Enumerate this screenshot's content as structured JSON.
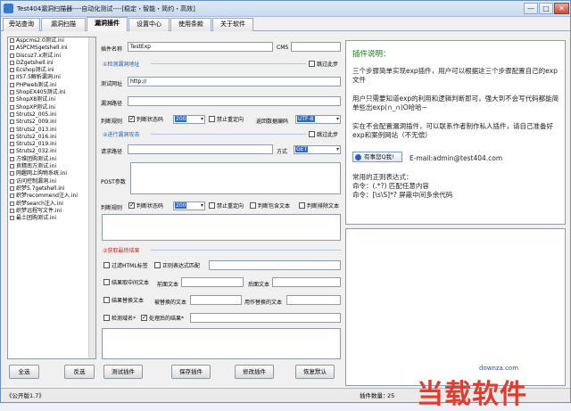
{
  "window": {
    "title": "Test404漏洞扫描器----自动化测试----[稳定・智能・简约・高效]",
    "controls": {
      "minimize": "—",
      "maximize": "□",
      "close": "✕"
    }
  },
  "tabs": [
    {
      "label": "旁站查询"
    },
    {
      "label": "漏洞扫描"
    },
    {
      "label": "漏洞插件",
      "active": true
    },
    {
      "label": "设置中心"
    },
    {
      "label": "使用条款"
    },
    {
      "label": "关于软件"
    }
  ],
  "plugin_list": [
    "Aspcms2.0测试.ini",
    "ASPCMSgetshell.ini",
    "Discuz7.x测试.ini",
    "DZgetshell.ini",
    "Ecshop测试.ini",
    "IIS7.5解析漏洞.ini",
    "PHPweb测试.ini",
    "ShopEX405测试.ini",
    "ShopX8测试.ini",
    "ShopXP测试.ini",
    "Struts2_005.ini",
    "Struts2_009.ini",
    "Struts2_013.ini",
    "Struts2_016.ini",
    "Struts2_019.ini",
    "Struts2_032.ini",
    "方维团购测试.ini",
    "良精南方测试.ini",
    "网趣网上购物系统.ini",
    "访问控制漏洞.ini",
    "织梦5.7getshell.ini",
    "织梦recommend注入.ini",
    "织梦search注入.ini",
    "织梦远程写文件.ini",
    "最土团购测试.ini"
  ],
  "form": {
    "plugin_name_label": "插件名称",
    "plugin_name_value": "TestExp",
    "cms_label": "CMS",
    "cms_value": "",
    "step1_title": "①检测漏洞地址",
    "step1_skip": "跳过此步",
    "test_url_label": "测试网址",
    "test_url_value": "http://",
    "vuln_path_label": "漏洞路径",
    "rule_label": "判断规则",
    "check_status_label": "判断状态码",
    "status_value": "200",
    "no_redirect_label": "禁止重定向",
    "encoding_label": "返回数据编码",
    "encoding_value": "UTF-8",
    "step2_title": "②进行漏洞攻击",
    "step2_skip": "跳过此步",
    "request_path_label": "请求路径",
    "method_label": "方式",
    "method_value": "GET",
    "post_params_label": "POST参数",
    "rule2_label": "判断规则",
    "check_status2_label": "判断状态码",
    "status2_value": "200",
    "no_redirect2_label": "禁止重定向",
    "check_contains_label": "判断包含文本",
    "check_exclude_label": "判断排除文本",
    "step3_title": "③获取最终结果",
    "filter_html_label": "过滤HTML标签",
    "regex_match_label": "正则表达式匹配",
    "extract_mid_label": "结果取中间文本",
    "front_text_label": "前面文本",
    "back_text_label": "后面文本",
    "replace_label": "结果替换文本",
    "replaced_text_label": "被替换的文本",
    "replacement_label": "用作替换的文本",
    "check_domain_label": "检测域名*",
    "processed_result_label": "处理后的结果*"
  },
  "buttons": {
    "select_all": "全选",
    "invert": "反选",
    "test_plugin": "测试插件",
    "save_plugin": "保存插件",
    "modify_plugin": "修改插件",
    "restore_default": "恢复默认"
  },
  "description": {
    "title": "插件说明：",
    "p1": "三个步骤简单实现exp插件，用户可以根据这三个步骤配置自己的exp文件",
    "p2": "用户只需要知道exp的利用和逻辑判断即可，强大到不会写代码都能简单些出exp(∩_∩)O哈哈~",
    "p3": "实在不会配置漏洞插件，可以联系作者制作私人插件，请自己准备好exp和案例网站（不无偿）",
    "qq_label": "有事您Q我!",
    "email": "E-mail:admin@test404.com",
    "regex_title": "常用的正则表达式：",
    "regex1": "命令：(.*?) 匹配任意内容",
    "regex2": "命令：[\\s\\S]*? 屏蔽中间多余代码"
  },
  "status": {
    "edition": "《公开版1.7》",
    "plugin_count_label": "插件数量：",
    "plugin_count": "25"
  },
  "watermark": {
    "url": "downza.com",
    "text": "当载软件"
  },
  "colors": {
    "section_blue": "#1b5fb6",
    "section_red": "#c8281e",
    "desc_title_green": "#1a7a1a",
    "watermark_red": "#e43b2d"
  }
}
